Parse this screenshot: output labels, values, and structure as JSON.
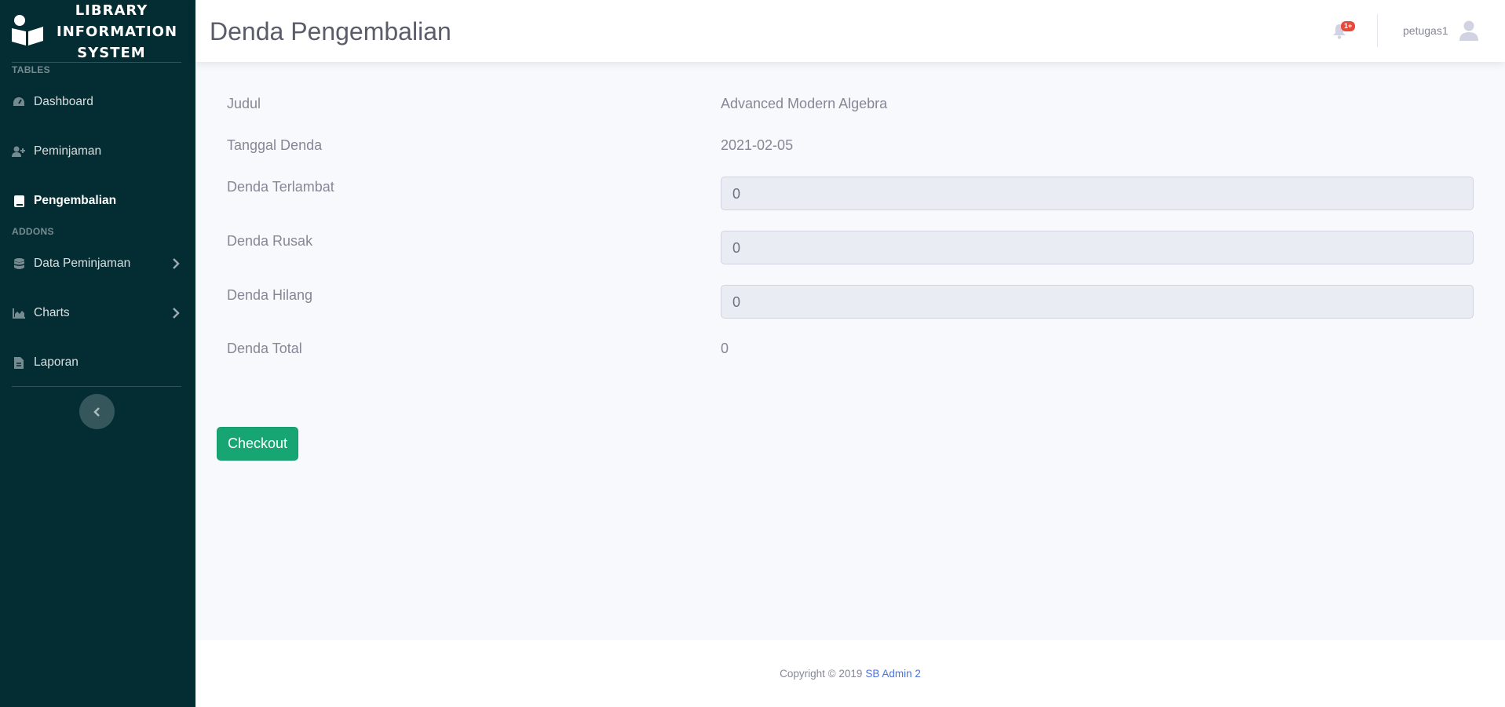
{
  "brand": {
    "lines": [
      "LIBRARY",
      "INFORMATION",
      "SYSTEM"
    ],
    "icon": "reader-icon"
  },
  "sidebar": {
    "heading_tables": "TABLES",
    "heading_addons": "ADDONS",
    "items": [
      {
        "label": "Dashboard",
        "icon": "tachometer-icon",
        "active": false
      },
      {
        "label": "Peminjaman",
        "icon": "user-plus-icon",
        "active": false
      },
      {
        "label": "Pengembalian",
        "icon": "book-icon",
        "active": true
      },
      {
        "label": "Data Peminjaman",
        "icon": "database-icon",
        "active": false,
        "chevron": true
      },
      {
        "label": "Charts",
        "icon": "chart-area-icon",
        "active": false,
        "chevron": true
      },
      {
        "label": "Laporan",
        "icon": "file-icon",
        "active": false
      }
    ]
  },
  "topbar": {
    "title": "Denda Pengembalian",
    "badge": "1+",
    "user": "petugas1"
  },
  "form": {
    "judul_label": "Judul",
    "judul_value": "Advanced Modern Algebra",
    "tanggal_label": "Tanggal Denda",
    "tanggal_value": "2021-02-05",
    "terlambat_label": "Denda Terlambat",
    "terlambat_value": "0",
    "rusak_label": "Denda Rusak",
    "rusak_value": "0",
    "hilang_label": "Denda Hilang",
    "hilang_value": "0",
    "total_label": "Denda Total",
    "total_value": "0",
    "checkout_label": "Checkout"
  },
  "footer": {
    "text": "Copyright © 2019",
    "link": "SB Admin 2"
  },
  "colors": {
    "sidebar_bg": "#032c33",
    "success": "#17a673",
    "badge": "#e74a3b",
    "link": "#4e73df"
  }
}
